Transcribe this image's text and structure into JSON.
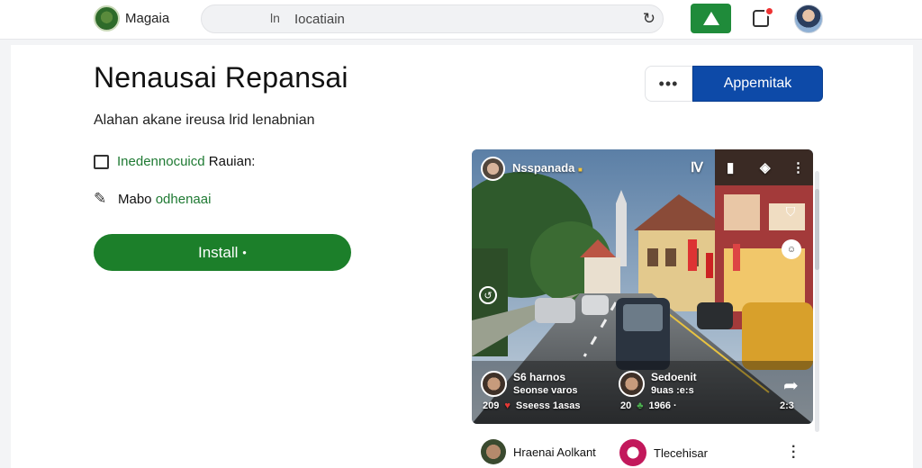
{
  "header": {
    "brand_name": "Magaia",
    "search_icon": "ln",
    "search_text": "Iocatiain",
    "refresh_icon": "refresh-icon",
    "alert_icon": "warning-icon",
    "notification_icon": "bell-icon"
  },
  "main": {
    "title": "Nenausai Repansai",
    "subtitle": "Alahan akane ireusa lrid lenabnian",
    "option1_prefix": "Inedennocuicd",
    "option1_suffix": "Rauian:",
    "option2_prefix": "Mabo",
    "option2_suffix": "odhenaai",
    "install_label": "Install",
    "install_suffix": "●",
    "more_label": "•••",
    "primary_label": "Appemitak"
  },
  "media": {
    "channel_name": "Nsspanada",
    "channel_badge": "■",
    "top_icons": [
      "Ⅳ",
      "▮",
      "◈",
      "⋮"
    ],
    "users": [
      {
        "name": "S6 harnos",
        "sub": "Seonse varos"
      },
      {
        "name": "Sedoenit",
        "sub": "9uas :e:s"
      }
    ],
    "stats_left": [
      "209",
      "♥",
      "Sseess 1asas"
    ],
    "stats_right": [
      "20",
      "♣",
      "1966 ·"
    ],
    "stats_far": "2:3"
  },
  "feed": {
    "item1": "Hraenai Aolkant",
    "item2": "Tlecehisar"
  },
  "colors": {
    "accent_green": "#1c7f2a",
    "primary_blue": "#0d4aa8"
  }
}
